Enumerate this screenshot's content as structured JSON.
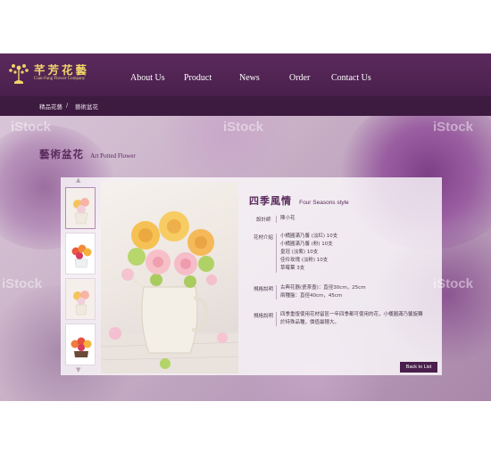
{
  "header": {
    "brand_title": "芊芳花藝",
    "brand_subtitle": "Cian-Fang Flower Company",
    "nav": [
      "About Us",
      "Product",
      "News",
      "Order",
      "Contact Us"
    ]
  },
  "breadcrumb": [
    "精品花藝",
    "/",
    "藝術盆花"
  ],
  "page_heading": {
    "zh": "藝術盆花",
    "en": "Art Potted Flower"
  },
  "watermark": "iStock",
  "product": {
    "title_zh": "四季風情",
    "title_en": "Four Seasons style",
    "details": [
      {
        "label": "設計師",
        "lines": [
          "陳小花"
        ]
      },
      {
        "label": "花材介紹",
        "lines": [
          "小桶圓滿乃馨 (淡紅) 10支",
          "小桶圓滿乃馨 (粉) 10支",
          "皇冠 (淡紫) 10支",
          "佳伶玫瑰 (淡粉) 10支",
          "草莓葉 3支"
        ]
      },
      {
        "label": "規格說明",
        "lines": [
          "古典花器(瓷茶壺)：直徑30cm，25cm",
          "兩種盤：直徑40cm，45cm"
        ]
      },
      {
        "label": "規格說明",
        "lines": [
          "四季重復使用花材留區一年四季都可使用的花，小桶圓滿乃馨旋轉",
          "於特殊品種，價值最穩大。"
        ]
      }
    ],
    "back_label": "Back to List"
  },
  "colors": {
    "brand_purple": "#4a1f4d",
    "gold": "#f0d36a",
    "accent_text": "#5a2a5c"
  }
}
